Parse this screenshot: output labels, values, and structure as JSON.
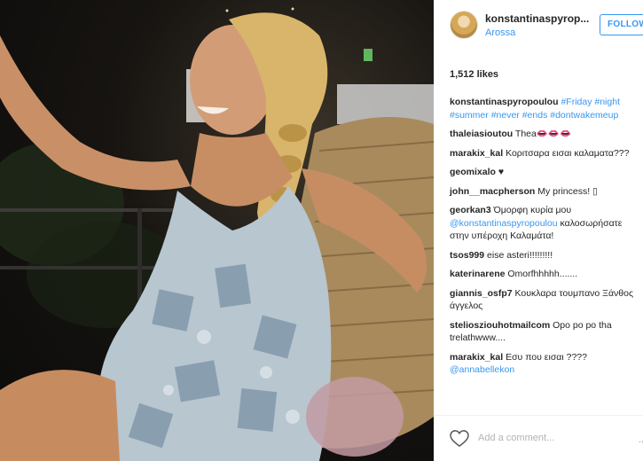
{
  "post": {
    "username": "konstantinaspyrop...",
    "location": "Arossa",
    "follow_label": "FOLLOW",
    "likes": "1,512 likes",
    "caption": {
      "user": "konstantinaspyropoulou",
      "tags": [
        "#Friday",
        "#night",
        "#summer",
        "#never",
        "#ends",
        "#dontwakemeup"
      ]
    },
    "comments": [
      {
        "user": "thaleiasioutou",
        "text": "Thea👄👄👄"
      },
      {
        "user": "marakix_kal",
        "text": "Κοριτσαρα εισαι καλαματα???"
      },
      {
        "user": "geomixalo",
        "text": "♥"
      },
      {
        "user": "john__macpherson",
        "text": "My princess! ▯"
      },
      {
        "user": "georkan3",
        "text": "Όμορφη κυρία μου",
        "mention": "@konstantinaspyropoulou",
        "text2": "καλοσωρήσατε στην υπέροχη Καλαμάτα!"
      },
      {
        "user": "tsos999",
        "text": "eise asteri!!!!!!!!!"
      },
      {
        "user": "katerinarene",
        "text": "Omorfhhhhh......."
      },
      {
        "user": "giannis_osfp7",
        "text": "Κουκλαρα τουμπανο Ξάνθος άγγελος"
      },
      {
        "user": "stelioszio​uhotmailcom",
        "text": "Opo po po tha trelathwww...."
      },
      {
        "user": "marakix_kal",
        "text": "Εσυ που εισαι ????",
        "mention": "@annabellekon"
      }
    ],
    "add_comment_placeholder": "Add a comment...",
    "more_label": "..."
  },
  "colors": {
    "link": "#3897f0",
    "text": "#262626",
    "muted": "#b3b3b3"
  },
  "icons": {
    "like": "heart-outline-icon",
    "avatar": "avatar"
  }
}
